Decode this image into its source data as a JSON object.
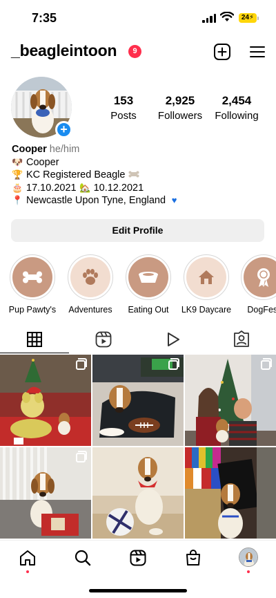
{
  "status_bar": {
    "time": "7:35",
    "battery": "24"
  },
  "header": {
    "username": "_beagleintoon",
    "notification_count": "9",
    "icons": [
      "new-post-icon",
      "menu-icon"
    ]
  },
  "stats": {
    "posts": {
      "value": "153",
      "label": "Posts"
    },
    "followers": {
      "value": "2,925",
      "label": "Followers"
    },
    "following": {
      "value": "2,454",
      "label": "Following"
    }
  },
  "bio": {
    "name": "Cooper",
    "pronouns": "he/him",
    "lines": [
      {
        "icon": "dog-face-icon",
        "text": "Cooper"
      },
      {
        "icon": "trophy-icon",
        "text": "KC Registered Beagle",
        "trail_icon": "bone-icon"
      },
      {
        "icon": "birthday-cake-icon",
        "text": "17.10.2021",
        "mid_icon": "new-home-icon",
        "text2": "10.12.2021"
      },
      {
        "icon": "map-pin-icon",
        "text": "Newcastle Upon Tyne, England",
        "trail_icon": "blue-heart-icon"
      }
    ]
  },
  "edit_profile_label": "Edit Profile",
  "highlights": [
    {
      "label": "Pup Pawty's",
      "icon": "bone-icon"
    },
    {
      "label": "Adventures",
      "icon": "paw-icon"
    },
    {
      "label": "Eating Out",
      "icon": "dog-bowl-icon"
    },
    {
      "label": "LK9 Daycare",
      "icon": "house-icon"
    },
    {
      "label": "DogFest",
      "icon": "award-ribbon-icon"
    }
  ],
  "profile_tabs": [
    "grid-icon",
    "reels-icon",
    "video-icon",
    "tagged-icon"
  ],
  "grid_posts": [
    {
      "description": "christmas",
      "multi": true
    },
    {
      "description": "football",
      "multi": true
    },
    {
      "description": "tree",
      "multi": true
    },
    {
      "description": "card",
      "multi": true
    },
    {
      "description": "ball",
      "multi": false
    },
    {
      "description": "worldcup",
      "multi": false
    }
  ],
  "bottom_nav": [
    "home-icon",
    "search-icon",
    "reels-icon",
    "shop-icon",
    "profile-avatar"
  ],
  "colors": {
    "accent_blue": "#1a8cf0",
    "badge_red": "#ff2e4c",
    "highlight_tan": "#c99a82"
  }
}
